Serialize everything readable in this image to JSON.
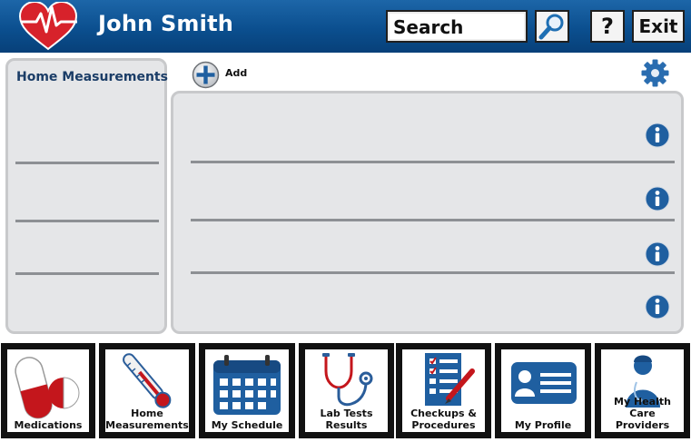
{
  "header": {
    "user_name": "John Smith",
    "search_label": "Search",
    "help_label": "?",
    "exit_label": "Exit",
    "logo_icon": "heart-pulse-icon",
    "search_icon": "magnifier-icon"
  },
  "left_panel": {
    "title": "Home Measurements"
  },
  "toolbar": {
    "add_label": "Add",
    "add_icon": "plus-circle-icon",
    "settings_icon": "gear-icon"
  },
  "main_panel": {
    "info_icon": "info-icon"
  },
  "nav": {
    "tiles": [
      {
        "label_lines": [
          "Medications"
        ],
        "icon": "pills-icon"
      },
      {
        "label_lines": [
          "Home",
          "Measurements"
        ],
        "icon": "thermometer-icon"
      },
      {
        "label_lines": [
          "My Schedule"
        ],
        "icon": "calendar-icon"
      },
      {
        "label_lines": [
          "Lab Tests",
          "Results"
        ],
        "icon": "stethoscope-icon"
      },
      {
        "label_lines": [
          "Checkups &",
          "Procedures"
        ],
        "icon": "checklist-icon"
      },
      {
        "label_lines": [
          "My Profile"
        ],
        "icon": "id-card-icon"
      },
      {
        "label_lines": [
          "My Health Care",
          "Providers"
        ],
        "icon": "doctor-icon"
      }
    ]
  },
  "colors": {
    "header_blue": "#0b4f8f",
    "panel_gray": "#e5e6e8",
    "accent_blue": "#1f5fa0",
    "heart_red": "#d7222b"
  }
}
